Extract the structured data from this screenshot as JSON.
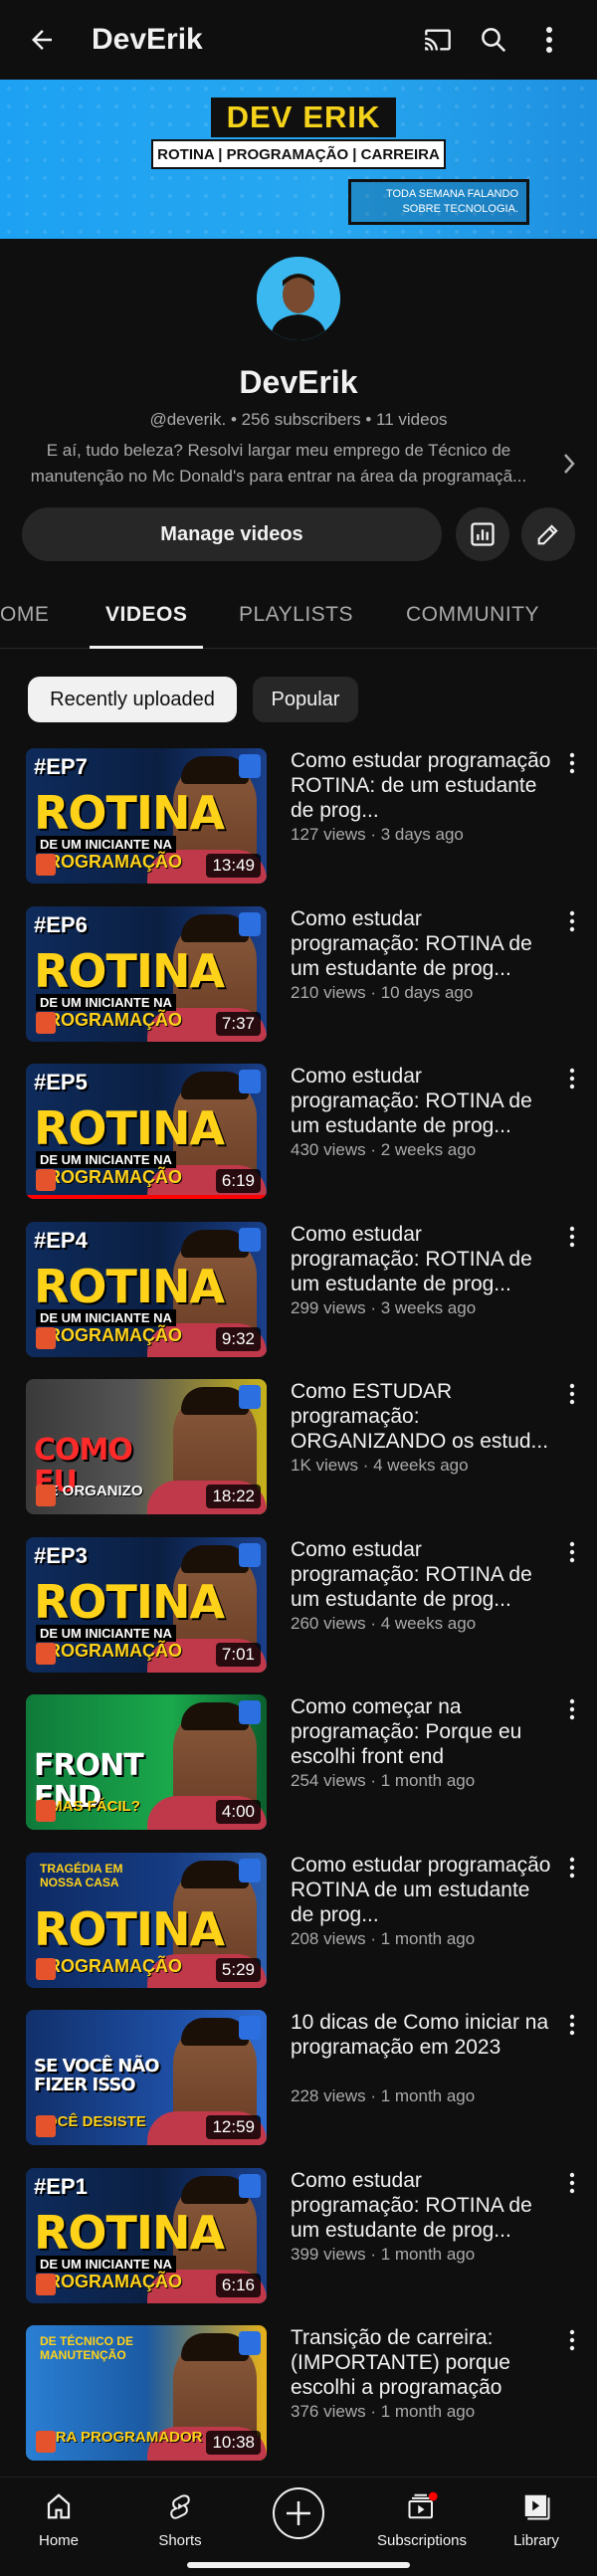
{
  "appbar": {
    "title": "DevErik"
  },
  "banner": {
    "brand_part1": "DEV",
    "brand_part2": "ERIK",
    "tagline": "ROTINA | PROGRAMAÇÃO | CARREIRA",
    "note_line1": "TODA SEMANA FALANDO",
    "note_line2": "SOBRE TECNOLOGIA."
  },
  "channel": {
    "name": "DevErik",
    "meta": "@deverik. • 256 subscribers • 11 videos",
    "description": "E aí, tudo beleza? Resolvi largar meu emprego de Técnico de manutenção no Mc Donald's para entrar na área da programaçã...",
    "manage_label": "Manage videos"
  },
  "tabs": [
    "OME",
    "VIDEOS",
    "PLAYLISTS",
    "COMMUNITY"
  ],
  "chips": [
    "Recently uploaded",
    "Popular"
  ],
  "videos": [
    {
      "ep": "#EP7",
      "duration": "13:49",
      "title": "Como estudar programação ROTINA: de um estudante de prog...",
      "meta": "127 views · 3 days ago",
      "kind": "rotina",
      "progress": 0
    },
    {
      "ep": "#EP6",
      "duration": "7:37",
      "title": "Como estudar programação: ROTINA de um estudante de prog...",
      "meta": "210 views · 10 days ago",
      "kind": "rotina",
      "progress": 0
    },
    {
      "ep": "#EP5",
      "duration": "6:19",
      "title": "Como estudar programação: ROTINA de um estudante de prog...",
      "meta": "430 views · 2 weeks ago",
      "kind": "rotina",
      "progress": 1.0
    },
    {
      "ep": "#EP4",
      "duration": "9:32",
      "title": "Como estudar programação: ROTINA de um estudante de prog...",
      "meta": "299 views · 3 weeks ago",
      "kind": "rotina",
      "progress": 0
    },
    {
      "ep": "",
      "duration": "18:22",
      "title": "Como ESTUDAR programação: ORGANIZANDO os estud...",
      "meta": "1K views · 4 weeks ago",
      "kind": "organizo",
      "progress": 0,
      "big": "COMO EU",
      "sub": "ME ORGANIZO"
    },
    {
      "ep": "#EP3",
      "duration": "7:01",
      "title": "Como estudar programação: ROTINA de um estudante de prog...",
      "meta": "260 views · 4 weeks ago",
      "kind": "rotina",
      "progress": 0
    },
    {
      "ep": "",
      "duration": "4:00",
      "title": "Como começar na programação: Porque eu escolhi front end",
      "meta": "254 views · 1 month ago",
      "kind": "frontend",
      "progress": 0,
      "big": "FRONT END",
      "sub": "É MAS FÁCIL?"
    },
    {
      "ep": "",
      "duration": "5:29",
      "title": "Como estudar programação ROTINA de um estudante de prog...",
      "meta": "208 views · 1 month ago",
      "kind": "tragedia",
      "progress": 0,
      "top": "TRAGÉDIA EM NOSSA CASA"
    },
    {
      "ep": "",
      "duration": "12:59",
      "title": "10 dicas de Como iniciar na programação em 2023",
      "meta": "228 views · 1 month ago",
      "kind": "desiste",
      "progress": 0,
      "big": "SE VOCÊ NÃO FIZER ISSO",
      "sub": "VOCÊ DESISTE"
    },
    {
      "ep": "#EP1",
      "duration": "6:16",
      "title": "Como estudar programação: ROTINA de um estudante de prog...",
      "meta": "399 views · 1 month ago",
      "kind": "rotina",
      "progress": 0
    },
    {
      "ep": "",
      "duration": "10:38",
      "title": "Transição de carreira: (IMPORTANTE) porque escolhi a programação",
      "meta": "376 views · 1 month ago",
      "kind": "transicao",
      "progress": 0,
      "top": "DE TÉCNICO DE MANUTENÇÃO",
      "sub": "PARA PROGRAMADOR"
    }
  ],
  "thumb_text": {
    "rotina": "ROTINA",
    "rotina_sub": "DE UM INICIANTE NA",
    "rotina_sub2": "PROGRAMAÇÃO"
  },
  "bottomnav": {
    "home": "Home",
    "shorts": "Shorts",
    "subscriptions": "Subscriptions",
    "library": "Library"
  },
  "colors": {
    "bg": "#0f0f0f",
    "accent": "#ff0000",
    "brand_yellow": "#f5d31a",
    "banner_blue": "#1da1f2"
  }
}
